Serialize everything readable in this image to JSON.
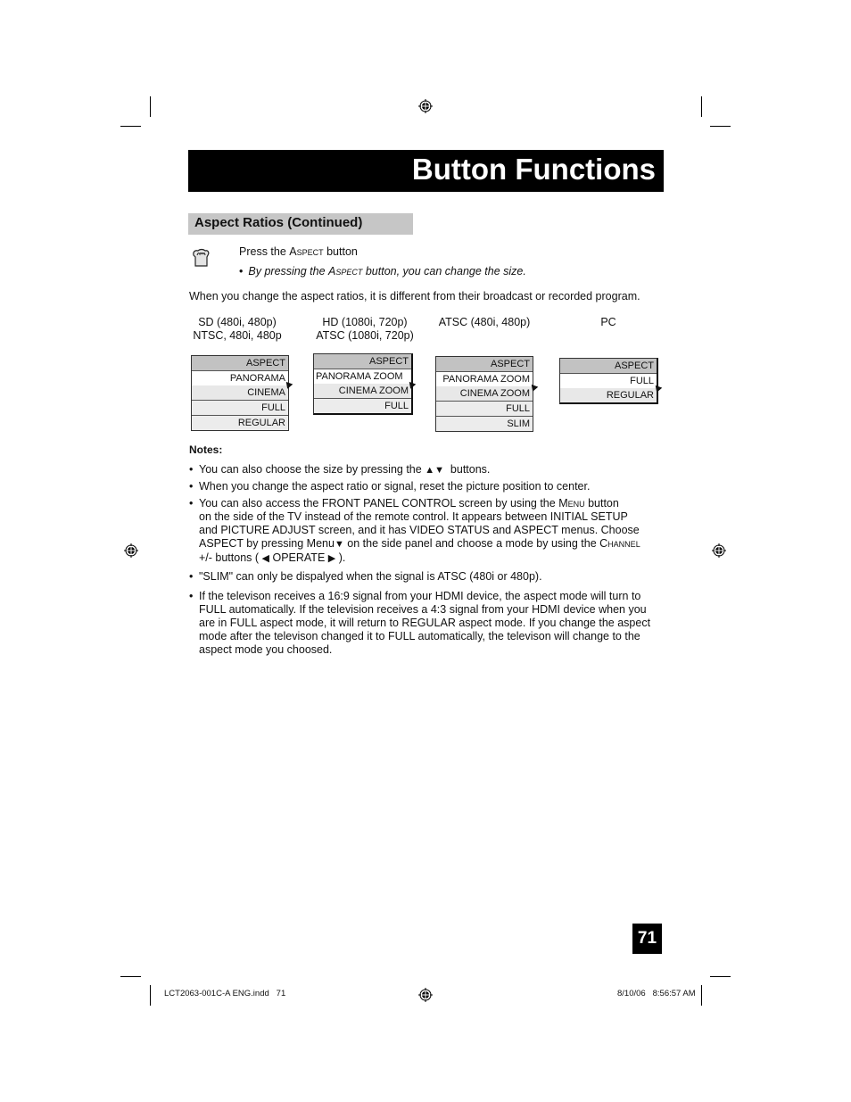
{
  "header": {
    "title": "Button Functions"
  },
  "section": {
    "title": "Aspect Ratios (Continued)"
  },
  "instruction": {
    "icon": "hand-press-icon",
    "press_prefix": "Press the ",
    "press_button": "Aspect",
    "press_suffix": " button",
    "bullet": "•",
    "sub_prefix": "By pressing the ",
    "sub_button": "Aspect",
    "sub_suffix": " button, you can change the size."
  },
  "intro": "When you change the aspect ratios, it is different from their broadcast or recorded program.",
  "menus": [
    {
      "caption_line1": "SD (480i, 480p)",
      "caption_line2": "NTSC, 480i, 480p",
      "header": "ASPECT",
      "items": [
        "PANORAMA",
        "CINEMA",
        "FULL",
        "REGULAR"
      ]
    },
    {
      "caption_line1": "HD (1080i, 720p)",
      "caption_line2": "ATSC (1080i, 720p)",
      "header": "ASPECT",
      "items": [
        "PANORAMA ZOOM",
        "CINEMA ZOOM",
        "FULL"
      ]
    },
    {
      "caption_line1": "ATSC (480i, 480p)",
      "caption_line2": "",
      "header": "ASPECT",
      "items": [
        "PANORAMA ZOOM",
        "CINEMA ZOOM",
        "FULL",
        "SLIM"
      ]
    },
    {
      "caption_line1": "PC",
      "caption_line2": "",
      "header": "ASPECT",
      "items": [
        "FULL",
        "REGULAR"
      ]
    }
  ],
  "notes": {
    "title": "Notes:",
    "bullet": "•",
    "n1_prefix": "You can also choose the size by pressing the ",
    "n1_arrows": "▲▼",
    "n1_suffix": "  buttons.",
    "n2": "When you change the aspect ratio or signal, reset the picture position to center.",
    "n3_l1a": "You can also access the FRONT PANEL CONTROL screen by using the ",
    "n3_l1b": "Menu",
    "n3_l1c": " button",
    "n3_l2": "on the side of the TV instead of the remote control.  It appears between INITIAL SETUP",
    "n3_l3": "and PICTURE ADJUST screen, and it has VIDEO STATUS and ASPECT menus. Choose",
    "n3_l4a": "ASPECT by pressing Menu",
    "n3_l4_arrow": "▼",
    "n3_l4b": " on the side panel and choose a mode by using the ",
    "n3_l4c": "Channel",
    "n3_l5a": "+/- buttons ( ",
    "n3_l5_left": "◀",
    "n3_l5b": " OPERATE ",
    "n3_l5_right": "▶",
    "n3_l5c": " ).",
    "n4": "\"SLIM\" can only be dispalyed when the signal is ATSC (480i or 480p).",
    "n5_l1": "If the televison receives a 16:9 signal from your HDMI device, the aspect mode will turn to",
    "n5_l2": "FULL automatically.  If the television receives a 4:3 signal from your HDMI device when you",
    "n5_l3": "are in FULL aspect mode, it will return to REGULAR aspect mode.  If you change the aspect",
    "n5_l4": "mode after the televison changed it to FULL automatically, the televison will change to the",
    "n5_l5": "aspect mode you choosed."
  },
  "page_number": "71",
  "footer": {
    "file": "LCT2063-001C-A ENG.indd   71",
    "timestamp": "8/10/06   8:56:57 AM"
  }
}
